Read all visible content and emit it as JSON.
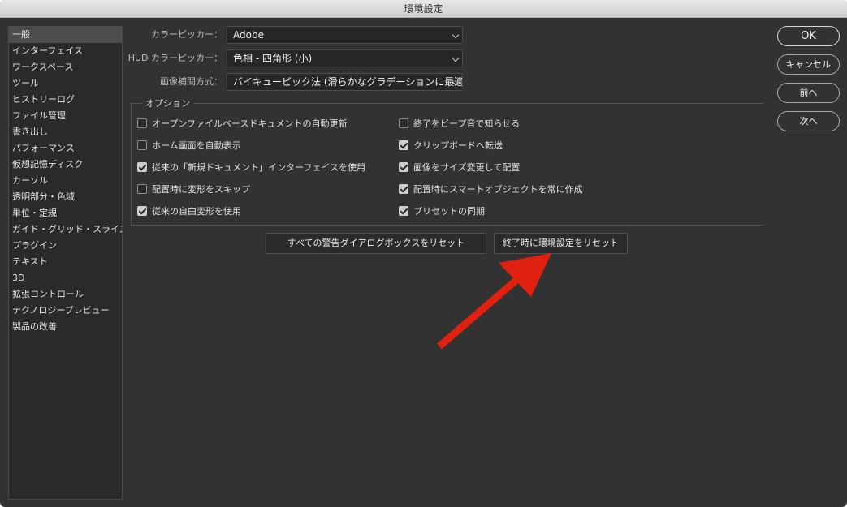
{
  "window": {
    "title": "環境設定"
  },
  "sidebar": {
    "items": [
      {
        "label": "一般",
        "selected": true
      },
      {
        "label": "インターフェイス"
      },
      {
        "label": "ワークスペース"
      },
      {
        "label": "ツール"
      },
      {
        "label": "ヒストリーログ"
      },
      {
        "label": "ファイル管理"
      },
      {
        "label": "書き出し"
      },
      {
        "label": "パフォーマンス"
      },
      {
        "label": "仮想記憶ディスク"
      },
      {
        "label": "カーソル"
      },
      {
        "label": "透明部分・色域"
      },
      {
        "label": "単位・定規"
      },
      {
        "label": "ガイド・グリッド・スライス"
      },
      {
        "label": "プラグイン"
      },
      {
        "label": "テキスト"
      },
      {
        "label": "3D"
      },
      {
        "label": "拡張コントロール"
      },
      {
        "label": "テクノロジープレビュー"
      },
      {
        "label": "製品の改善"
      }
    ]
  },
  "general": {
    "color_picker": {
      "label": "カラーピッカー：",
      "value": "Adobe"
    },
    "hud_color_picker": {
      "label": "HUD カラーピッカー：",
      "value": "色相 - 四角形 (小)"
    },
    "interpolation": {
      "label": "画像補間方式：",
      "value": "バイキュービック法 (滑らかなグラデーションに最適)"
    }
  },
  "options": {
    "title": "オプション",
    "left": [
      {
        "label": "オープンファイルベースドキュメントの自動更新",
        "checked": false
      },
      {
        "label": "ホーム画面を自動表示",
        "checked": false
      },
      {
        "label": "従来の「新規ドキュメント」インターフェイスを使用",
        "checked": true
      },
      {
        "label": "配置時に変形をスキップ",
        "checked": false
      },
      {
        "label": "従来の自由変形を使用",
        "checked": true
      }
    ],
    "right": [
      {
        "label": "終了をビープ音で知らせる",
        "checked": false
      },
      {
        "label": "クリップボードへ転送",
        "checked": true
      },
      {
        "label": "画像をサイズ変更して配置",
        "checked": true
      },
      {
        "label": "配置時にスマートオブジェクトを常に作成",
        "checked": true
      },
      {
        "label": "プリセットの同期",
        "checked": true
      }
    ]
  },
  "reset": {
    "warnings_label": "すべての警告ダイアログボックスをリセット",
    "prefs_label": "終了時に環境設定をリセット"
  },
  "buttons": {
    "ok": "OK",
    "cancel": "キャンセル",
    "prev": "前へ",
    "next": "次へ"
  },
  "annotation": {
    "arrow_color": "#e0210f"
  }
}
